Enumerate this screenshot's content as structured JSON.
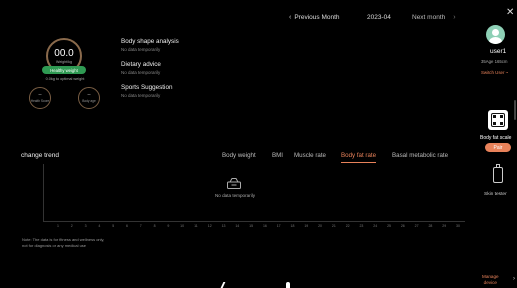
{
  "header": {
    "prev_label": "Previous Month",
    "current_month": "2023-04",
    "next_label": "Next month"
  },
  "summary": {
    "weight_value": "00.0",
    "weight_label": "Weight/kg",
    "status_badge": "Healthy weight",
    "optimal_text": "0.0kg to optimal weight",
    "health_score_value": "--",
    "health_score_label": "Health Score",
    "body_age_value": "--",
    "body_age_label": "Body age"
  },
  "analysis": [
    {
      "title": "Body shape analysis",
      "status": "No data temporarily"
    },
    {
      "title": "Dietary advice",
      "status": "No data temporarily"
    },
    {
      "title": "Sports Suggestion",
      "status": "No data temporarily"
    }
  ],
  "trend": {
    "title": "change trend",
    "tabs": [
      "Body weight",
      "BMI",
      "Muscle rate",
      "Body fat rate",
      "Basal metabolic rate"
    ],
    "active_tab": "Body fat rate",
    "empty_text": "No data temporarily",
    "x_ticks": [
      "1",
      "2",
      "3",
      "4",
      "5",
      "6",
      "7",
      "8",
      "9",
      "10",
      "11",
      "12",
      "13",
      "14",
      "15",
      "16",
      "17",
      "18",
      "19",
      "20",
      "21",
      "22",
      "23",
      "24",
      "25",
      "26",
      "27",
      "28",
      "29",
      "30"
    ]
  },
  "note": {
    "line1": "Note: The data is for fitness and wellness only,",
    "line2": "not for diagnosis or any medical use"
  },
  "sidebar": {
    "close_icon": "close-icon",
    "username": "user1",
    "user_meta": "35Age 165cm",
    "switch_user": "Switch User ~",
    "device1_label": "Body fat scale",
    "pair_label": "Pair",
    "device2_label": "Skin tester",
    "manage_line1": "Manage",
    "manage_line2": "device",
    "accent_color": "#e8825a"
  }
}
